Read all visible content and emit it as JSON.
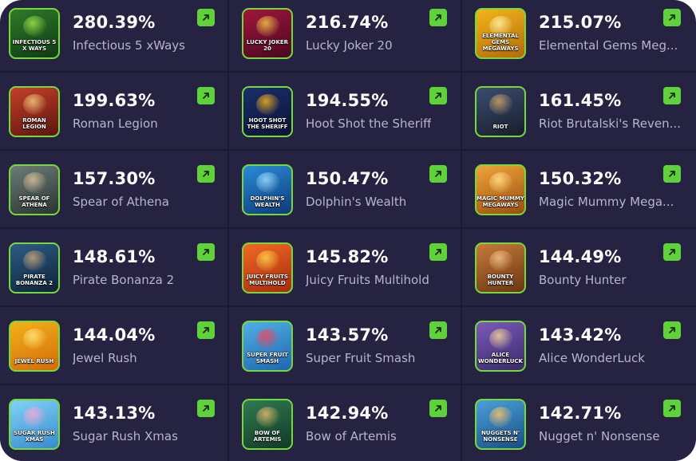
{
  "games": [
    {
      "pct": "280.39%",
      "name": "Infectious 5 xWays",
      "thumb_label": "INFECTIOUS 5 X WAYS",
      "color_a": "#2f7a2a",
      "color_b": "#0f3a14",
      "deco": "#9be34a"
    },
    {
      "pct": "216.74%",
      "name": "Lucky Joker 20",
      "thumb_label": "LUCKY JOKER 20",
      "color_a": "#a0163c",
      "color_b": "#4a0820",
      "deco": "#f4c64a"
    },
    {
      "pct": "215.07%",
      "name": "Elemental Gems Meg...",
      "thumb_label": "ELEMENTAL GEMS MEGAWAYS",
      "color_a": "#f2b51c",
      "color_b": "#b46a0a",
      "deco": "#fff1a3"
    },
    {
      "pct": "199.63%",
      "name": "Roman Legion",
      "thumb_label": "ROMAN LEGION",
      "color_a": "#c6402a",
      "color_b": "#5a150f",
      "deco": "#f0c87a"
    },
    {
      "pct": "194.55%",
      "name": "Hoot Shot the Sheriff",
      "thumb_label": "HOOT SHOT THE SHERIFF",
      "color_a": "#1b2e6b",
      "color_b": "#0b1336",
      "deco": "#f2b21c"
    },
    {
      "pct": "161.45%",
      "name": "Riot Brutalski's Reven...",
      "thumb_label": "RIOT",
      "color_a": "#3b4d6e",
      "color_b": "#181d2e",
      "deco": "#c9a46a"
    },
    {
      "pct": "157.30%",
      "name": "Spear of Athena",
      "thumb_label": "SPEAR OF ATHENA",
      "color_a": "#6d7c78",
      "color_b": "#2b3432",
      "deco": "#d8c29a"
    },
    {
      "pct": "150.47%",
      "name": "Dolphin's Wealth",
      "thumb_label": "DOLPHIN'S WEALTH",
      "color_a": "#2a8bd8",
      "color_b": "#0c3b7a",
      "deco": "#9fdcff"
    },
    {
      "pct": "150.32%",
      "name": "Magic Mummy Mega...",
      "thumb_label": "MAGIC MUMMY MEGAWAYS",
      "color_a": "#f0a43a",
      "color_b": "#9a4e0e",
      "deco": "#ffe08a"
    },
    {
      "pct": "148.61%",
      "name": "Pirate Bonanza 2",
      "thumb_label": "PIRATE BONANZA 2",
      "color_a": "#2c5c86",
      "color_b": "#0f2238",
      "deco": "#caa47a"
    },
    {
      "pct": "145.82%",
      "name": "Juicy Fruits Multihold",
      "thumb_label": "JUICY FRUITS MULTIHOLD",
      "color_a": "#f06a24",
      "color_b": "#a82a0c",
      "deco": "#ffd34a"
    },
    {
      "pct": "144.49%",
      "name": "Bounty Hunter",
      "thumb_label": "BOUNTY HUNTER",
      "color_a": "#c77a3a",
      "color_b": "#6a3512",
      "deco": "#f1c38a"
    },
    {
      "pct": "144.04%",
      "name": "Jewel Rush",
      "thumb_label": "JEWEL RUSH",
      "color_a": "#f5b21a",
      "color_b": "#d26a0a",
      "deco": "#ffe37a"
    },
    {
      "pct": "143.57%",
      "name": "Super Fruit Smash",
      "thumb_label": "SUPER FRUIT SMASH",
      "color_a": "#4fb0e6",
      "color_b": "#1f66b0",
      "deco": "#f0445a"
    },
    {
      "pct": "143.42%",
      "name": "Alice WonderLuck",
      "thumb_label": "ALICE WONDERLUCK",
      "color_a": "#7a5ab8",
      "color_b": "#3a2a6a",
      "deco": "#f6d39a"
    },
    {
      "pct": "143.13%",
      "name": "Sugar Rush Xmas",
      "thumb_label": "SUGAR RUSH XMAS",
      "color_a": "#7fd3f5",
      "color_b": "#3a8ad0",
      "deco": "#f7a6d8"
    },
    {
      "pct": "142.94%",
      "name": "Bow of Artemis",
      "thumb_label": "BOW OF ARTEMIS",
      "color_a": "#2f7a52",
      "color_b": "#123a26",
      "deco": "#e8b86a"
    },
    {
      "pct": "142.71%",
      "name": "Nugget n' Nonsense",
      "thumb_label": "NUGGETS N' NONSENSE",
      "color_a": "#4aa0d8",
      "color_b": "#1a4e86",
      "deco": "#f4c36a"
    }
  ],
  "colors": {
    "panel": "#262342",
    "accent": "#5fd13a",
    "text": "#ffffff",
    "muted": "#b7b4cf"
  },
  "icons": {
    "open": "external-arrow-icon"
  }
}
